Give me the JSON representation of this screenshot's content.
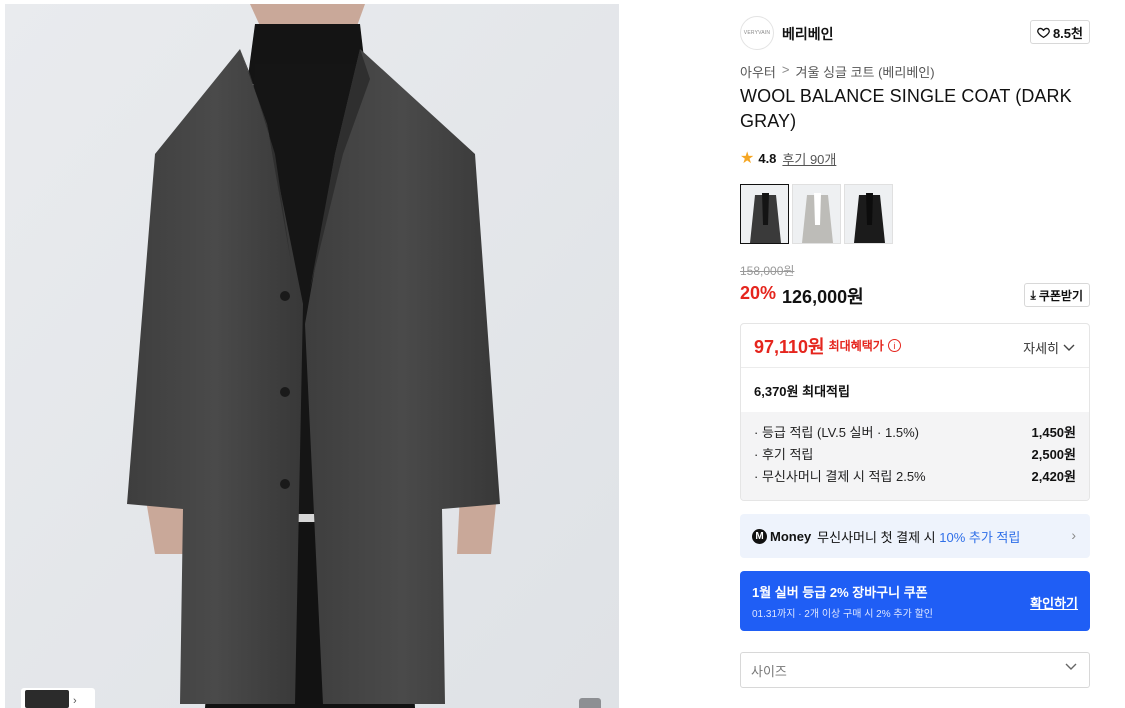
{
  "brand": {
    "logo_text": "VERYVAIN",
    "name": "베리베인",
    "likes": "8.5천"
  },
  "breadcrumb": {
    "category": "아우터",
    "separator": ">",
    "collection": "겨울 싱글 코트 (베리베인)"
  },
  "product": {
    "title": "WOOL BALANCE SINGLE COAT (DARK GRAY)",
    "rating": "4.8",
    "reviews": "후기 90개",
    "original_price": "158,000원",
    "discount": "20%",
    "price": "126,000원",
    "coupon_button": "쿠폰받기"
  },
  "swatches": [
    {
      "color": "dark gray",
      "hex": "#3a3a3a",
      "selected": true
    },
    {
      "color": "light gray",
      "hex": "#bdbcb8",
      "selected": false
    },
    {
      "color": "black",
      "hex": "#1b1b1b",
      "selected": false
    }
  ],
  "benefit": {
    "max_price": "97,110원",
    "max_label": "최대혜택가",
    "detail_toggle": "자세히",
    "points_total": "6,370원 최대적립",
    "items": [
      {
        "label": "· 등급 적립 (LV.5 실버 · 1.5%)",
        "amount": "1,450원"
      },
      {
        "label": "· 후기 적립",
        "amount": "2,500원"
      },
      {
        "label": "· 무신사머니 결제 시 적립 2.5%",
        "amount": "2,420원"
      }
    ]
  },
  "money_banner": {
    "logo": "M",
    "word": "Money",
    "text": "무신사머니 첫 결제 시 ",
    "highlight": "10% 추가 적립"
  },
  "coupon_banner": {
    "title": "1월 실버 등급 2% 장바구니 쿠폰",
    "subtitle": "01.31까지 · 2개 이상 구매 시 2% 추가 할인",
    "action": "확인하기"
  },
  "size_select": {
    "placeholder": "사이즈"
  },
  "colors": {
    "accent_red": "#e5251d",
    "accent_blue": "#1f5ef5",
    "link_blue": "#2f6fe8"
  }
}
